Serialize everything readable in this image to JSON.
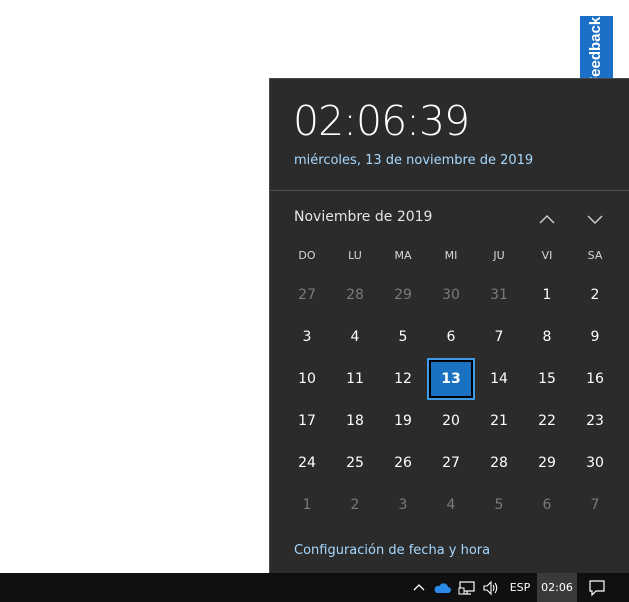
{
  "feedback": {
    "label": "Feedback"
  },
  "flyout": {
    "time": "02:06:39",
    "date_long": "miércoles, 13 de noviembre de 2019",
    "month_title": "Noviembre de 2019",
    "weekdays": [
      "DO",
      "LU",
      "MA",
      "MI",
      "JU",
      "VI",
      "SA"
    ],
    "days": [
      {
        "label": "27",
        "muted": true
      },
      {
        "label": "28",
        "muted": true
      },
      {
        "label": "29",
        "muted": true
      },
      {
        "label": "30",
        "muted": true
      },
      {
        "label": "31",
        "muted": true
      },
      {
        "label": "1"
      },
      {
        "label": "2"
      },
      {
        "label": "3"
      },
      {
        "label": "4"
      },
      {
        "label": "5"
      },
      {
        "label": "6"
      },
      {
        "label": "7"
      },
      {
        "label": "8"
      },
      {
        "label": "9"
      },
      {
        "label": "10"
      },
      {
        "label": "11"
      },
      {
        "label": "12"
      },
      {
        "label": "13",
        "today": true
      },
      {
        "label": "14"
      },
      {
        "label": "15"
      },
      {
        "label": "16"
      },
      {
        "label": "17"
      },
      {
        "label": "18"
      },
      {
        "label": "19"
      },
      {
        "label": "20"
      },
      {
        "label": "21"
      },
      {
        "label": "22"
      },
      {
        "label": "23"
      },
      {
        "label": "24"
      },
      {
        "label": "25"
      },
      {
        "label": "26"
      },
      {
        "label": "27"
      },
      {
        "label": "28"
      },
      {
        "label": "29"
      },
      {
        "label": "30"
      },
      {
        "label": "1",
        "muted": true
      },
      {
        "label": "2",
        "muted": true
      },
      {
        "label": "3",
        "muted": true
      },
      {
        "label": "4",
        "muted": true
      },
      {
        "label": "5",
        "muted": true
      },
      {
        "label": "6",
        "muted": true
      },
      {
        "label": "7",
        "muted": true
      }
    ],
    "settings_link": "Configuración de fecha y hora",
    "nav_up_icon": "chevron-up-icon",
    "nav_down_icon": "chevron-down-icon"
  },
  "taskbar": {
    "language": "ESP",
    "clock": "02:06",
    "icons": [
      "chevron-up-icon",
      "onedrive-cloud-icon",
      "network-icon",
      "volume-icon",
      "action-center-icon"
    ]
  },
  "colors": {
    "flyout_bg": "#2b2b2b",
    "accent": "#1b72c2",
    "link": "#a6d8ff",
    "taskbar_bg": "#101010",
    "feedback_bg": "#1b6fc6"
  }
}
